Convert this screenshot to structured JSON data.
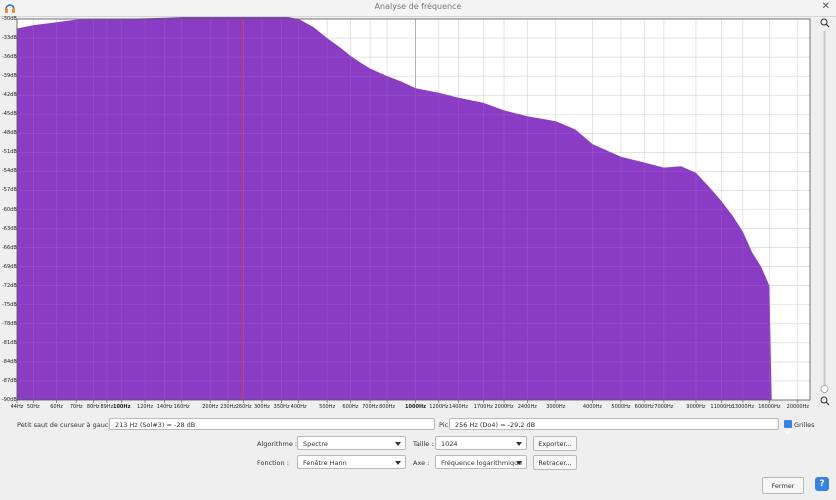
{
  "window": {
    "title": "Analyse de fréquence"
  },
  "chart_data": {
    "type": "area",
    "fill_color": "#8a3dc4",
    "cursor_color": "#d43b3b",
    "scale": "log",
    "xlim": [
      44,
      22000
    ],
    "ylim": [
      -90,
      -30
    ],
    "yticks": [
      "-30dB",
      "-33dB",
      "-36dB",
      "-39dB",
      "-42dB",
      "-45dB",
      "-48dB",
      "-51dB",
      "-54dB",
      "-57dB",
      "-60dB",
      "-63dB",
      "-66dB",
      "-69dB",
      "-72dB",
      "-75dB",
      "-78dB",
      "-81dB",
      "-84dB",
      "-87dB",
      "-90dB"
    ],
    "xticks": [
      {
        "f": 44,
        "label": "44Hz"
      },
      {
        "f": 50,
        "label": "50Hz"
      },
      {
        "f": 60,
        "label": "60Hz"
      },
      {
        "f": 70,
        "label": "70Hz"
      },
      {
        "f": 80,
        "label": "80Hz"
      },
      {
        "f": 89,
        "label": "89Hz"
      },
      {
        "f": 100,
        "label": "100Hz",
        "bold": true
      },
      {
        "f": 120,
        "label": "120Hz"
      },
      {
        "f": 140,
        "label": "140Hz"
      },
      {
        "f": 160,
        "label": "160Hz"
      },
      {
        "f": 200,
        "label": "200Hz"
      },
      {
        "f": 230,
        "label": "230Hz"
      },
      {
        "f": 260,
        "label": "260Hz"
      },
      {
        "f": 300,
        "label": "300Hz"
      },
      {
        "f": 350,
        "label": "350Hz"
      },
      {
        "f": 400,
        "label": "400Hz"
      },
      {
        "f": 500,
        "label": "500Hz"
      },
      {
        "f": 600,
        "label": "600Hz"
      },
      {
        "f": 700,
        "label": "700Hz"
      },
      {
        "f": 800,
        "label": "800Hz"
      },
      {
        "f": 1000,
        "label": "1000Hz",
        "bold": true
      },
      {
        "f": 1200,
        "label": "1200Hz"
      },
      {
        "f": 1400,
        "label": "1400Hz"
      },
      {
        "f": 1700,
        "label": "1700Hz"
      },
      {
        "f": 2000,
        "label": "2000Hz"
      },
      {
        "f": 2400,
        "label": "2400Hz"
      },
      {
        "f": 3000,
        "label": "3000Hz"
      },
      {
        "f": 4000,
        "label": "4000Hz"
      },
      {
        "f": 5000,
        "label": "5000Hz"
      },
      {
        "f": 6000,
        "label": "6000Hz"
      },
      {
        "f": 7000,
        "label": "7000Hz"
      },
      {
        "f": 9000,
        "label": "9000Hz"
      },
      {
        "f": 11000,
        "label": "11000Hz"
      },
      {
        "f": 13000,
        "label": "13000Hz"
      },
      {
        "f": 16000,
        "label": "16000Hz"
      },
      {
        "f": 20000,
        "label": "20000Hz"
      }
    ],
    "cursor_hz": 256,
    "spectrum": [
      [
        44,
        -31.5
      ],
      [
        50,
        -31.0
      ],
      [
        60,
        -30.5
      ],
      [
        70,
        -30.1
      ],
      [
        80,
        -30.0
      ],
      [
        100,
        -30.0
      ],
      [
        140,
        -29.8
      ],
      [
        180,
        -29.6
      ],
      [
        220,
        -29.3
      ],
      [
        256,
        -29.2
      ],
      [
        300,
        -29.3
      ],
      [
        350,
        -29.5
      ],
      [
        400,
        -30.0
      ],
      [
        450,
        -31.3
      ],
      [
        500,
        -33.0
      ],
      [
        550,
        -34.4
      ],
      [
        600,
        -35.8
      ],
      [
        650,
        -36.9
      ],
      [
        700,
        -37.8
      ],
      [
        800,
        -39.0
      ],
      [
        900,
        -39.9
      ],
      [
        1000,
        -40.9
      ],
      [
        1200,
        -41.6
      ],
      [
        1400,
        -42.4
      ],
      [
        1700,
        -43.2
      ],
      [
        2000,
        -44.4
      ],
      [
        2400,
        -45.3
      ],
      [
        3000,
        -46.1
      ],
      [
        3500,
        -47.4
      ],
      [
        4000,
        -49.7
      ],
      [
        5000,
        -51.7
      ],
      [
        6000,
        -52.6
      ],
      [
        7000,
        -53.4
      ],
      [
        8000,
        -53.2
      ],
      [
        9000,
        -54.2
      ],
      [
        10000,
        -56.5
      ],
      [
        11000,
        -58.7
      ],
      [
        12000,
        -61.0
      ],
      [
        13000,
        -63.5
      ],
      [
        14000,
        -66.8
      ],
      [
        15000,
        -69.0
      ],
      [
        16000,
        -72.0
      ],
      [
        16300,
        -90.0
      ]
    ]
  },
  "controls": {
    "cursor_label": "Petit saut de curseur à gauche",
    "cursor_value": "213 Hz (Sol#3) = -28 dB",
    "peak_label": "Pic",
    "peak_value": "256 Hz (Do4) = -29,2 dB",
    "grids_label": "Grilles",
    "algorithm_label": "Algorithme :",
    "algorithm_value": "Spectre",
    "size_label": "Taille :",
    "size_value": "1024",
    "export_label": "Exporter...",
    "function_label": "Fonction :",
    "function_value": "Fenêtre Hann",
    "axis_label": "Axe :",
    "axis_value": "Fréquence logarithmique",
    "replot_label": "Retracer...",
    "close_label": "Fermer",
    "help_label": "?"
  }
}
